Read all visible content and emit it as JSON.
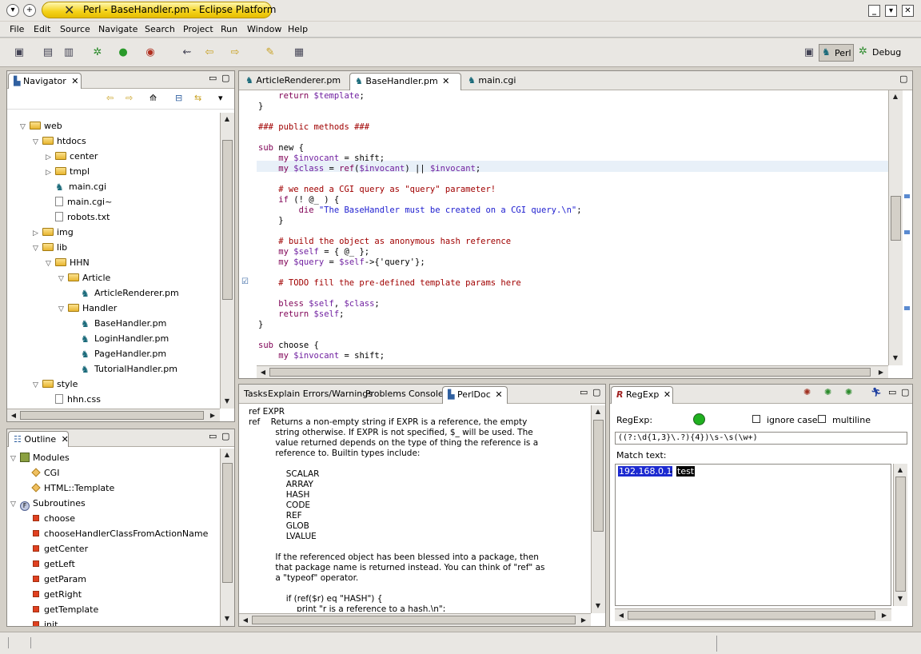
{
  "window": {
    "title": "Perl - BaseHandler.pm - Eclipse Platform",
    "controls": [
      "minimize",
      "maximize",
      "close"
    ]
  },
  "menu": [
    "File",
    "Edit",
    "Source",
    "Navigate",
    "Search",
    "Project",
    "Run",
    "Window",
    "Help"
  ],
  "perspectives": {
    "perl": "Perl",
    "debug": "Debug"
  },
  "navigator": {
    "title": "Navigator",
    "items": [
      {
        "label": "web",
        "indent": 0,
        "type": "folder",
        "state": "open"
      },
      {
        "label": "htdocs",
        "indent": 1,
        "type": "folder",
        "state": "open"
      },
      {
        "label": "center",
        "indent": 2,
        "type": "folder",
        "state": "closed"
      },
      {
        "label": "tmpl",
        "indent": 2,
        "type": "folder",
        "state": "closed"
      },
      {
        "label": "main.cgi",
        "indent": 2,
        "type": "perl",
        "state": ""
      },
      {
        "label": "main.cgi~",
        "indent": 2,
        "type": "file",
        "state": ""
      },
      {
        "label": "robots.txt",
        "indent": 2,
        "type": "file",
        "state": ""
      },
      {
        "label": "img",
        "indent": 1,
        "type": "folder",
        "state": "closed"
      },
      {
        "label": "lib",
        "indent": 1,
        "type": "folder",
        "state": "open"
      },
      {
        "label": "HHN",
        "indent": 2,
        "type": "folder",
        "state": "open"
      },
      {
        "label": "Article",
        "indent": 3,
        "type": "folder",
        "state": "open"
      },
      {
        "label": "ArticleRenderer.pm",
        "indent": 4,
        "type": "perl",
        "state": ""
      },
      {
        "label": "Handler",
        "indent": 3,
        "type": "folder",
        "state": "open"
      },
      {
        "label": "BaseHandler.pm",
        "indent": 4,
        "type": "perl",
        "state": ""
      },
      {
        "label": "LoginHandler.pm",
        "indent": 4,
        "type": "perl",
        "state": ""
      },
      {
        "label": "PageHandler.pm",
        "indent": 4,
        "type": "perl",
        "state": ""
      },
      {
        "label": "TutorialHandler.pm",
        "indent": 4,
        "type": "perl",
        "state": ""
      },
      {
        "label": "style",
        "indent": 1,
        "type": "folder",
        "state": "open"
      },
      {
        "label": "hhn.css",
        "indent": 2,
        "type": "file",
        "state": ""
      }
    ]
  },
  "outline": {
    "title": "Outline",
    "items": [
      {
        "label": "Modules",
        "indent": 0,
        "icon": "modules"
      },
      {
        "label": "CGI",
        "indent": 1,
        "icon": "module"
      },
      {
        "label": "HTML::Template",
        "indent": 1,
        "icon": "module"
      },
      {
        "label": "Subroutines",
        "indent": 0,
        "icon": "subs"
      },
      {
        "label": "choose",
        "indent": 1,
        "icon": "sub"
      },
      {
        "label": "chooseHandlerClassFromActionName",
        "indent": 1,
        "icon": "sub"
      },
      {
        "label": "getCenter",
        "indent": 1,
        "icon": "sub"
      },
      {
        "label": "getLeft",
        "indent": 1,
        "icon": "sub"
      },
      {
        "label": "getParam",
        "indent": 1,
        "icon": "sub"
      },
      {
        "label": "getRight",
        "indent": 1,
        "icon": "sub"
      },
      {
        "label": "getTemplate",
        "indent": 1,
        "icon": "sub"
      },
      {
        "label": "init",
        "indent": 1,
        "icon": "sub"
      }
    ]
  },
  "editor": {
    "tabs": [
      "ArticleRenderer.pm",
      "BaseHandler.pm",
      "main.cgi"
    ],
    "active": 1,
    "lines": [
      [
        [
          "    return ",
          "kw"
        ],
        [
          "$template",
          "vr"
        ],
        [
          ";",
          ""
        ]
      ],
      [
        [
          "}",
          ""
        ]
      ],
      [
        [
          "",
          ""
        ]
      ],
      [
        [
          "### public methods ###",
          "cm"
        ]
      ],
      [
        [
          "",
          ""
        ]
      ],
      [
        [
          "sub ",
          "kw"
        ],
        [
          "new {",
          ""
        ]
      ],
      [
        [
          "    my ",
          "kw"
        ],
        [
          "$invocant",
          "vr"
        ],
        [
          " = shift;",
          ""
        ]
      ],
      [
        [
          "    my ",
          "kw"
        ],
        [
          "$class",
          "vr"
        ],
        [
          " = ",
          ""
        ],
        [
          "ref",
          "kw"
        ],
        [
          "(",
          ""
        ],
        [
          "$invocant",
          "vr"
        ],
        [
          ") || ",
          ""
        ],
        [
          "$invocant",
          "vr"
        ],
        [
          ";",
          ""
        ]
      ],
      [
        [
          "",
          ""
        ]
      ],
      [
        [
          "    # we need a CGI query as \"query\" parameter!",
          "cm"
        ]
      ],
      [
        [
          "    if ",
          "kw"
        ],
        [
          "(! @_ ) {",
          ""
        ]
      ],
      [
        [
          "        die ",
          "kw"
        ],
        [
          "\"The BaseHandler must be created on a CGI query.\\n\"",
          "st"
        ],
        [
          ";",
          ""
        ]
      ],
      [
        [
          "    }",
          ""
        ]
      ],
      [
        [
          "",
          ""
        ]
      ],
      [
        [
          "    # build the object as anonymous hash reference",
          "cm"
        ]
      ],
      [
        [
          "    my ",
          "kw"
        ],
        [
          "$self",
          "vr"
        ],
        [
          " = { @_ };",
          ""
        ]
      ],
      [
        [
          "    my ",
          "kw"
        ],
        [
          "$query",
          "vr"
        ],
        [
          " = ",
          ""
        ],
        [
          "$self",
          "vr"
        ],
        [
          "->{'query'};",
          ""
        ]
      ],
      [
        [
          "",
          ""
        ]
      ],
      [
        [
          "    # TODO fill the pre-defined template params here",
          "cm"
        ]
      ],
      [
        [
          "",
          ""
        ]
      ],
      [
        [
          "    bless ",
          "kw"
        ],
        [
          "$self",
          "vr"
        ],
        [
          ", ",
          ""
        ],
        [
          "$class",
          "vr"
        ],
        [
          ";",
          ""
        ]
      ],
      [
        [
          "    return ",
          "kw"
        ],
        [
          "$self",
          "vr"
        ],
        [
          ";",
          ""
        ]
      ],
      [
        [
          "}",
          ""
        ]
      ],
      [
        [
          "",
          ""
        ]
      ],
      [
        [
          "sub ",
          "kw"
        ],
        [
          "choose {",
          ""
        ]
      ],
      [
        [
          "    my ",
          "kw"
        ],
        [
          "$invocant",
          "vr"
        ],
        [
          " = shift;",
          ""
        ]
      ]
    ]
  },
  "bottom_tabs": [
    "Tasks",
    "Explain Errors/Warnings",
    "Problems",
    "Console",
    "PerlDoc"
  ],
  "perldoc": {
    "lines": [
      "ref EXPR",
      "ref    Returns a non-empty string if EXPR is a reference, the empty",
      "          string otherwise. If EXPR is not specified, $_ will be used. The",
      "          value returned depends on the type of thing the reference is a",
      "          reference to. Builtin types include:",
      "",
      "              SCALAR",
      "              ARRAY",
      "              HASH",
      "              CODE",
      "              REF",
      "              GLOB",
      "              LVALUE",
      "",
      "          If the referenced object has been blessed into a package, then",
      "          that package name is returned instead. You can think of \"ref\" as",
      "          a \"typeof\" operator.",
      "",
      "              if (ref($r) eq \"HASH\") {",
      "                  print \"r is a reference to a hash.\\n\";"
    ]
  },
  "regexp": {
    "title": "RegExp",
    "label_regexp": "RegExp:",
    "ignore_case": "ignore case",
    "multiline": "multiline",
    "pattern": "((?:\\d{1,3}\\.?){4})\\s-\\s(\\w+)",
    "match_label": "Match text:",
    "match_ip": "192.168.0.1",
    "match_sep": " - ",
    "match_word": "test",
    "status_color": "#20b020"
  }
}
